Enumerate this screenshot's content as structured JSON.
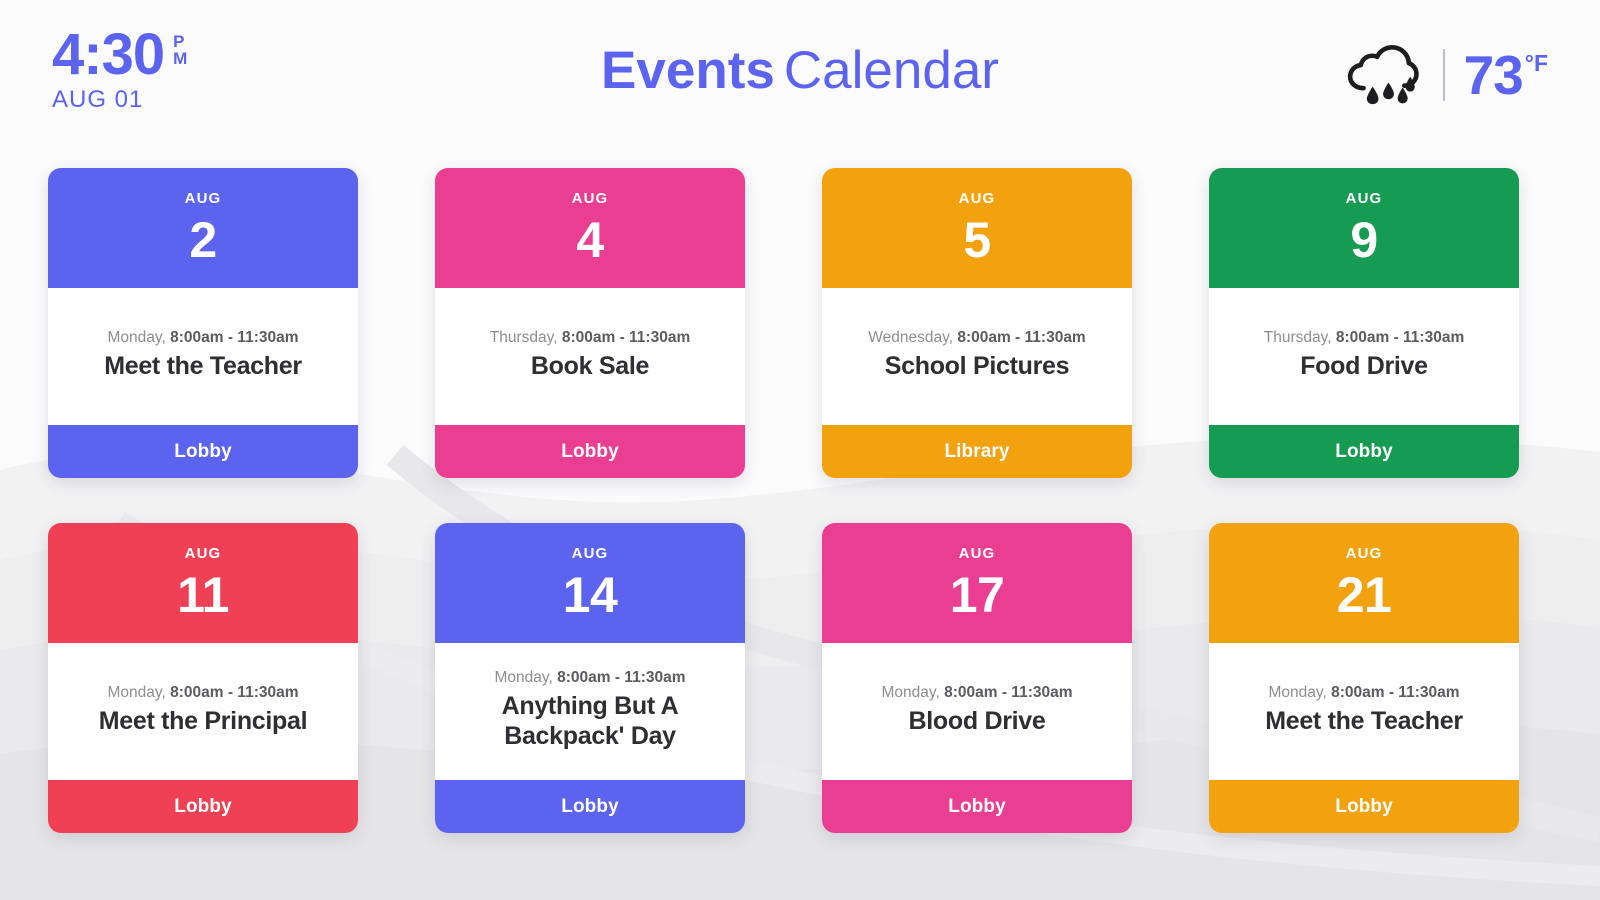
{
  "header": {
    "clock": {
      "time": "4:30",
      "meridiem_top": "P",
      "meridiem_bottom": "M",
      "date": "AUG 01"
    },
    "title": {
      "bold": "Events",
      "light": "Calendar"
    },
    "weather": {
      "icon": "rain-cloud-icon",
      "temperature": "73",
      "unit": "°F"
    }
  },
  "colors": {
    "blue": "#5C63EE",
    "pink": "#EA3E92",
    "orange": "#F2A10F",
    "green": "#159B52",
    "red": "#EF4056",
    "card_body": "#FFFFFF",
    "page_background": "#FBFBFC",
    "title_text": "#2E2E33",
    "when_day_text": "#8D8D92",
    "when_time_text": "#5B5B60"
  },
  "events": [
    {
      "month": "AUG",
      "day": "2",
      "weekday": "Monday, ",
      "time": "8:00am - 11:30am",
      "title": "Meet the Teacher",
      "location": "Lobby",
      "color": "#5C63EE"
    },
    {
      "month": "AUG",
      "day": "4",
      "weekday": "Thursday, ",
      "time": "8:00am - 11:30am",
      "title": "Book Sale",
      "location": "Lobby",
      "color": "#EA3E92"
    },
    {
      "month": "AUG",
      "day": "5",
      "weekday": "Wednesday, ",
      "time": "8:00am - 11:30am",
      "title": "School Pictures",
      "location": "Library",
      "color": "#F2A10F"
    },
    {
      "month": "AUG",
      "day": "9",
      "weekday": "Thursday, ",
      "time": "8:00am - 11:30am",
      "title": "Food Drive",
      "location": "Lobby",
      "color": "#159B52"
    },
    {
      "month": "AUG",
      "day": "11",
      "weekday": "Monday, ",
      "time": "8:00am - 11:30am",
      "title": "Meet the Principal",
      "location": "Lobby",
      "color": "#EF4056"
    },
    {
      "month": "AUG",
      "day": "14",
      "weekday": "Monday, ",
      "time": "8:00am - 11:30am",
      "title": "Anything But A Backpack' Day",
      "location": "Lobby",
      "color": "#5C63EE"
    },
    {
      "month": "AUG",
      "day": "17",
      "weekday": "Monday, ",
      "time": "8:00am - 11:30am",
      "title": "Blood Drive",
      "location": "Lobby",
      "color": "#EA3E92"
    },
    {
      "month": "AUG",
      "day": "21",
      "weekday": "Monday, ",
      "time": "8:00am - 11:30am",
      "title": "Meet the Teacher",
      "location": "Lobby",
      "color": "#F2A10F"
    }
  ]
}
